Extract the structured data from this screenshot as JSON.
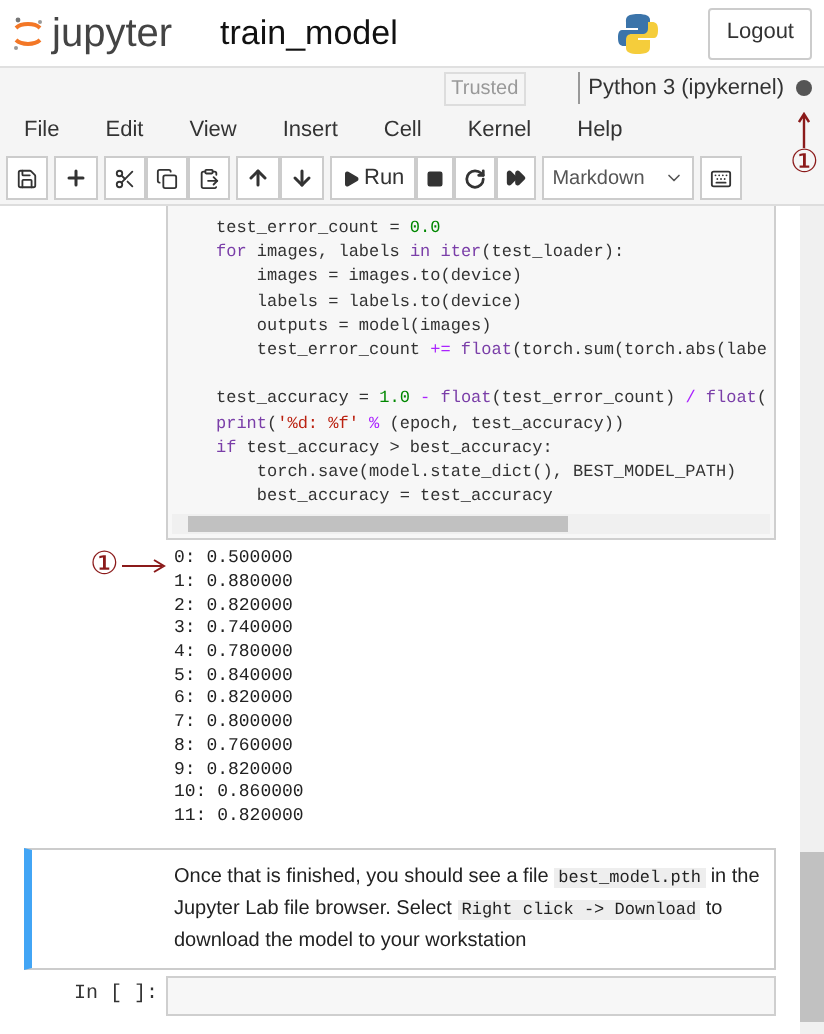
{
  "header": {
    "logo_text": "jupyter",
    "notebook_name": "train_model",
    "logout": "Logout"
  },
  "kernel_bar": {
    "trusted": "Trusted",
    "kernel": "Python 3 (ipykernel)"
  },
  "menu": [
    "File",
    "Edit",
    "View",
    "Insert",
    "Cell",
    "Kernel",
    "Help"
  ],
  "toolbar": {
    "run": "Run",
    "cell_type": "Markdown"
  },
  "annotations": [
    {
      "kind": "up",
      "mark": "①"
    },
    {
      "kind": "right",
      "mark": "①"
    }
  ],
  "code_cell": {
    "blocks": [
      [
        [
          {
            "t": "test_error_count = ",
            "kind": "plain"
          },
          {
            "t": "0.0",
            "kind": "number"
          }
        ],
        [
          {
            "t": "for",
            "kind": "keyword"
          },
          {
            "t": " images, labels ",
            "kind": "plain"
          },
          {
            "t": "in",
            "kind": "keyword"
          },
          {
            "t": " iter",
            "kind": "keyword"
          },
          {
            "t": "(test_loader):",
            "kind": "plain"
          }
        ],
        [
          {
            "t": "    images = images.to(device)",
            "kind": "plain"
          }
        ],
        [
          {
            "t": "    labels = labels.to(device)",
            "kind": "plain"
          }
        ],
        [
          {
            "t": "    outputs = model(images)",
            "kind": "plain"
          }
        ],
        [
          {
            "t": "    test_error_count ",
            "kind": "plain"
          },
          {
            "t": "+=",
            "kind": "operator"
          },
          {
            "t": " float",
            "kind": "keyword"
          },
          {
            "t": "(torch.sum(torch.abs(labe",
            "kind": "plain"
          }
        ]
      ],
      [
        [
          {
            "t": "test_accuracy = ",
            "kind": "plain"
          },
          {
            "t": "1.0",
            "kind": "number"
          },
          {
            "t": " - ",
            "kind": "operator"
          },
          {
            "t": "float",
            "kind": "keyword"
          },
          {
            "t": "(test_error_count) ",
            "kind": "plain"
          },
          {
            "t": "/",
            "kind": "operator"
          },
          {
            "t": " float",
            "kind": "keyword"
          },
          {
            "t": "(",
            "kind": "plain"
          }
        ],
        [
          {
            "t": "print",
            "kind": "keyword"
          },
          {
            "t": "(",
            "kind": "plain"
          },
          {
            "t": "'%d: %f'",
            "kind": "string"
          },
          {
            "t": " %",
            "kind": "operator"
          },
          {
            "t": " (epoch, test_accuracy))",
            "kind": "plain"
          }
        ],
        [
          {
            "t": "if",
            "kind": "keyword"
          },
          {
            "t": " test_accuracy > best_accuracy:",
            "kind": "plain"
          }
        ],
        [
          {
            "t": "    torch.save(model.state_dict(), BEST_MODEL_PATH)",
            "kind": "plain"
          }
        ],
        [
          {
            "t": "    best_accuracy = test_accuracy",
            "kind": "plain"
          }
        ]
      ]
    ]
  },
  "output": [
    "0: 0.500000",
    "1: 0.880000",
    "2: 0.820000",
    "3: 0.740000",
    "4: 0.780000",
    "5: 0.840000",
    "6: 0.820000",
    "7: 0.800000",
    "8: 0.760000",
    "9: 0.820000",
    "10: 0.860000",
    "11: 0.820000"
  ],
  "markdown_cell": {
    "selected": true,
    "parts": [
      {
        "t": "Once that is finished, you should see a file ",
        "kind": "text"
      },
      {
        "t": "best_model.pth",
        "kind": "code"
      },
      {
        "t": " in the Jupyter Lab file browser. Select ",
        "kind": "text"
      },
      {
        "t": "Right click -> Download",
        "kind": "code"
      },
      {
        "t": " to download the model to your workstation",
        "kind": "text"
      }
    ]
  },
  "empty_cell": {
    "prompt": "In [ ]:"
  }
}
